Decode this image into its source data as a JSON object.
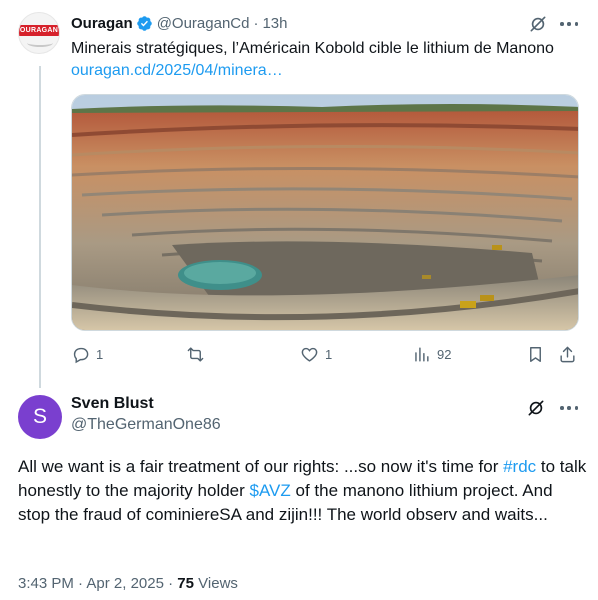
{
  "parent_tweet": {
    "avatar_text": "OURAGAN",
    "display_name": "Ouragan",
    "handle": "@OuraganCd",
    "separator": "·",
    "time": "13h",
    "text": "Minerais stratégiques, l’Américain Kobold cible le lithium de Manono ",
    "link_text": "ouragan.cd/2025/04/minera…",
    "media_alt": "open-pit mine photo",
    "replies": "1",
    "reposts": "",
    "likes": "1",
    "views": "92"
  },
  "main_tweet": {
    "avatar_letter": "S",
    "avatar_color": "#7a3fcf",
    "display_name": "Sven Blust",
    "handle": "@TheGermanOne86",
    "text_part1": "All we want is a fair treatment of our rights: ...so now it's time for ",
    "hashtag": "#rdc",
    "text_part2": " to talk honestly to the majority holder ",
    "cashtag": "$AVZ",
    "text_part3": " of the manono lithium project. And stop the fraud of cominiereSA and zijin!!! The world observ and waits...",
    "time": "3:43 PM",
    "separator": "·",
    "date": "Apr 2, 2025",
    "views_count": "75",
    "views_label": "Views"
  },
  "colors": {
    "link": "#1d9bf0",
    "muted": "#536471",
    "verified": "#1d9bf0"
  }
}
